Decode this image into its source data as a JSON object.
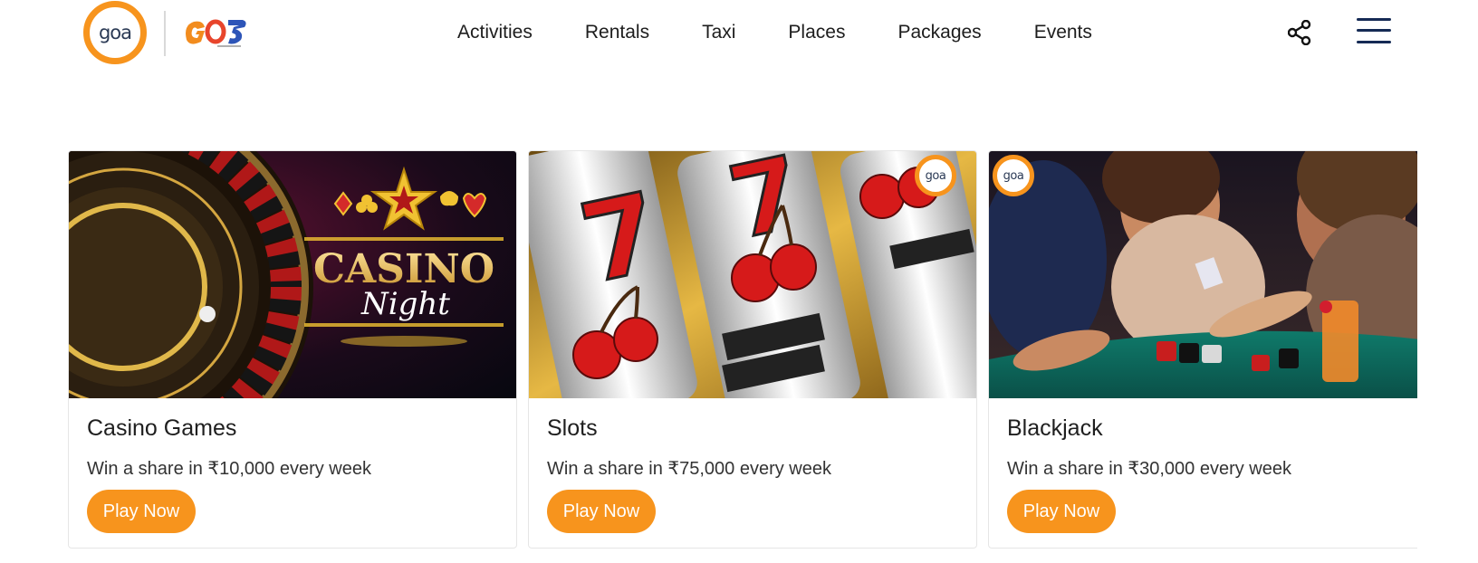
{
  "header": {
    "logo_text": "goa",
    "nav": [
      "Activities",
      "Rentals",
      "Taxi",
      "Places",
      "Packages",
      "Events"
    ]
  },
  "cards": [
    {
      "title": "Casino Games",
      "description": "Win a share in ₹10,000 every week",
      "button": "Play Now",
      "image_text_1": "CASINO",
      "image_text_2": "Night"
    },
    {
      "title": "Slots",
      "description": "Win a share in ₹75,000 every week",
      "button": "Play Now",
      "badge": "goa"
    },
    {
      "title": "Blackjack",
      "description": "Win a share in ₹30,000 every week",
      "button": "Play Now",
      "badge": "goa"
    }
  ],
  "colors": {
    "accent": "#f7941d",
    "navy": "#152a55"
  }
}
